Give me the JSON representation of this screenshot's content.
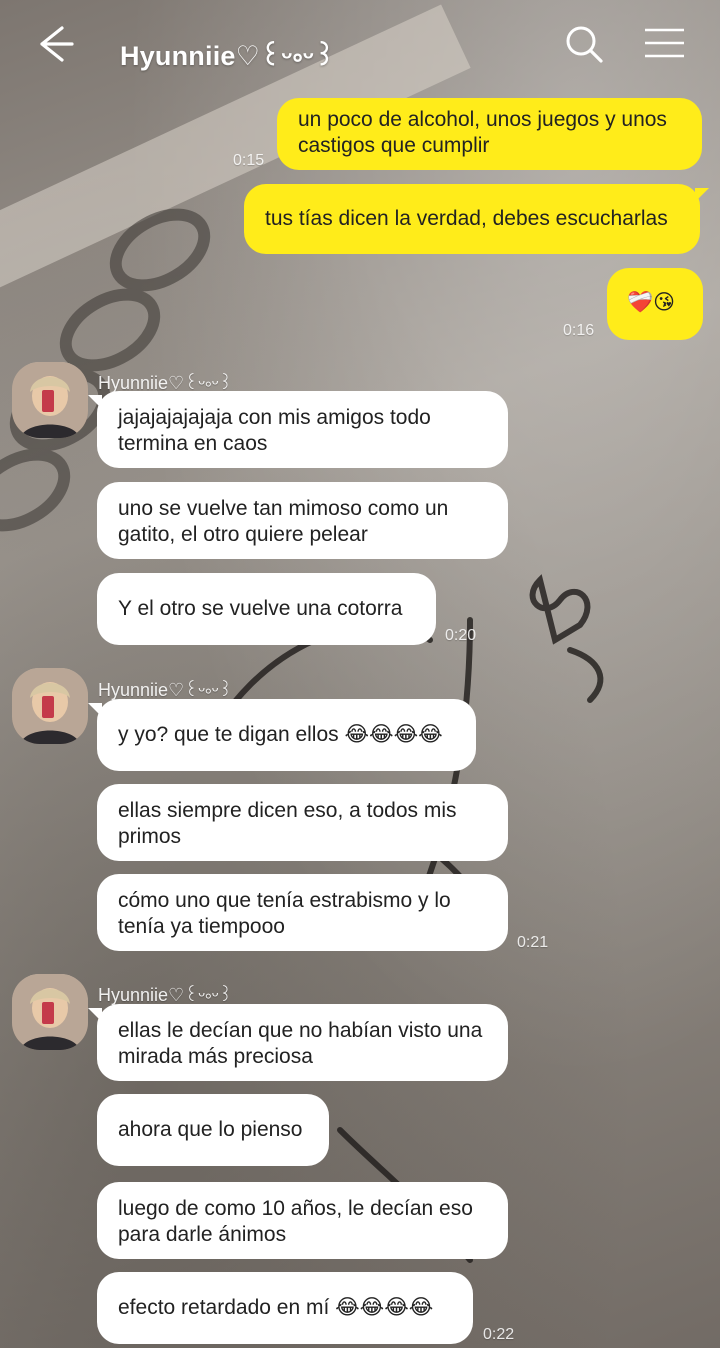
{
  "header": {
    "title": "Hyunniie♡꒰ᵕ༚ᵕ꒱",
    "back_icon": "arrow-left-icon",
    "search_icon": "search-icon",
    "menu_icon": "hamburger-menu-icon"
  },
  "colors": {
    "my_bubble": "#ffec1a",
    "their_bubble": "#ffffff",
    "header_text": "#ffffff"
  },
  "messages": {
    "m1": {
      "text": "un poco de alcohol, unos juegos y unos castigos que cumplir",
      "time": "0:15"
    },
    "m2": {
      "text": "tus tías dicen la verdad, debes escucharlas"
    },
    "m3": {
      "text": "❤️‍🩹😘",
      "time": "0:16"
    },
    "g1": {
      "sender": "Hyunniie♡꒰ᵕ༚ᵕ꒱",
      "b1": "jajajajajajaja con mis amigos todo termina en caos",
      "b2": "uno se vuelve tan mimoso como un gatito, el otro quiere pelear",
      "b3": "Y el otro se vuelve una cotorra",
      "time": "0:20"
    },
    "g2": {
      "sender": "Hyunniie♡꒰ᵕ༚ᵕ꒱",
      "b1": "y yo? que te digan ellos 😂😂😂😂",
      "b2": "ellas siempre dicen eso, a todos mis primos",
      "b3": "cómo uno que tenía estrabismo y lo tenía ya tiempooo",
      "time": "0:21"
    },
    "g3": {
      "sender": "Hyunniie♡꒰ᵕ༚ᵕ꒱",
      "b1": "ellas le decían que no habían visto una mirada más preciosa",
      "b2": "ahora que lo pienso",
      "b3": "luego de como 10 años, le decían eso para darle ánimos",
      "b4": "efecto retardado en mí 😂😂😂😂",
      "time": "0:22"
    }
  }
}
